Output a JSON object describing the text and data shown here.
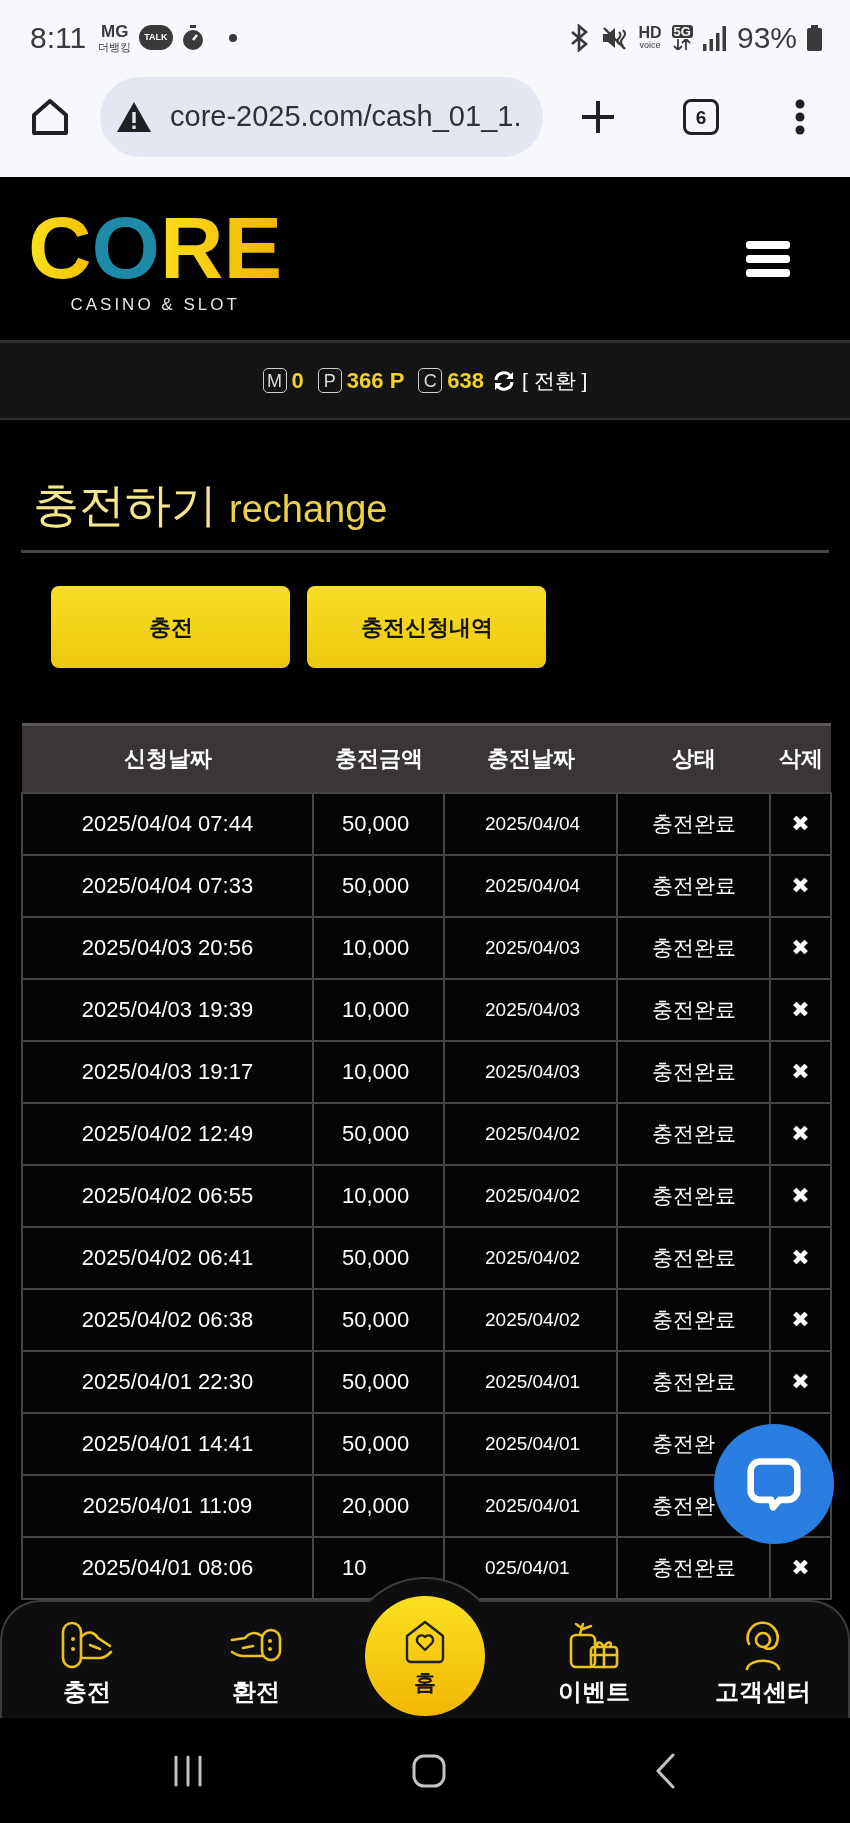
{
  "status_bar": {
    "time": "8:11",
    "app_badge": {
      "top": "MG",
      "bottom": "더뱅킹"
    },
    "chat_badge": "TALK",
    "hd_label": "HD",
    "hd_sub": "voice",
    "network": "5G",
    "battery": "93%"
  },
  "browser": {
    "url": "core-2025.com/cash_01_1.",
    "tab_count": "6"
  },
  "header": {
    "logo": "CORE",
    "tagline": "CASINO & SLOT"
  },
  "balances": [
    {
      "badge": "M",
      "value": "0"
    },
    {
      "badge": "P",
      "value": "366 P"
    },
    {
      "badge": "C",
      "value": "638"
    }
  ],
  "switch_label": "[ 전환 ]",
  "title": {
    "main": "충전하기",
    "sub": "rechange"
  },
  "buttons": [
    "충전",
    "충전신청내역"
  ],
  "table": {
    "columns": [
      "신청날짜",
      "충전금액",
      "충전날짜",
      "상태",
      "삭제"
    ],
    "rows": [
      {
        "requested_at": "2025/04/04 07:44",
        "amount": "50,000",
        "charged_on": "2025/04/04",
        "status": "충전완료",
        "delete": "✖"
      },
      {
        "requested_at": "2025/04/04 07:33",
        "amount": "50,000",
        "charged_on": "2025/04/04",
        "status": "충전완료",
        "delete": "✖"
      },
      {
        "requested_at": "2025/04/03 20:56",
        "amount": "10,000",
        "charged_on": "2025/04/03",
        "status": "충전완료",
        "delete": "✖"
      },
      {
        "requested_at": "2025/04/03 19:39",
        "amount": "10,000",
        "charged_on": "2025/04/03",
        "status": "충전완료",
        "delete": "✖"
      },
      {
        "requested_at": "2025/04/03 19:17",
        "amount": "10,000",
        "charged_on": "2025/04/03",
        "status": "충전완료",
        "delete": "✖"
      },
      {
        "requested_at": "2025/04/02 12:49",
        "amount": "50,000",
        "charged_on": "2025/04/02",
        "status": "충전완료",
        "delete": "✖"
      },
      {
        "requested_at": "2025/04/02 06:55",
        "amount": "10,000",
        "charged_on": "2025/04/02",
        "status": "충전완료",
        "delete": "✖"
      },
      {
        "requested_at": "2025/04/02 06:41",
        "amount": "50,000",
        "charged_on": "2025/04/02",
        "status": "충전완료",
        "delete": "✖"
      },
      {
        "requested_at": "2025/04/02 06:38",
        "amount": "50,000",
        "charged_on": "2025/04/02",
        "status": "충전완료",
        "delete": "✖"
      },
      {
        "requested_at": "2025/04/01 22:30",
        "amount": "50,000",
        "charged_on": "2025/04/01",
        "status": "충전완료",
        "delete": "✖"
      },
      {
        "requested_at": "2025/04/01 14:41",
        "amount": "50,000",
        "charged_on": "2025/04/01",
        "status": "충전완"
      },
      {
        "requested_at": "2025/04/01 11:09",
        "amount": "20,000",
        "charged_on": "2025/04/01",
        "status": "충전완"
      },
      {
        "requested_at": "2025/04/01 08:06",
        "amount": "10",
        "charged_on": "025/04/01",
        "status": "충전완료",
        "delete": "✖"
      }
    ]
  },
  "bottom_nav": [
    {
      "kind": "charge",
      "label": "충전"
    },
    {
      "kind": "exchange",
      "label": "환전"
    },
    {
      "kind": "home",
      "label": "홈"
    },
    {
      "kind": "event",
      "label": "이벤트"
    },
    {
      "kind": "support",
      "label": "고객센터"
    }
  ]
}
